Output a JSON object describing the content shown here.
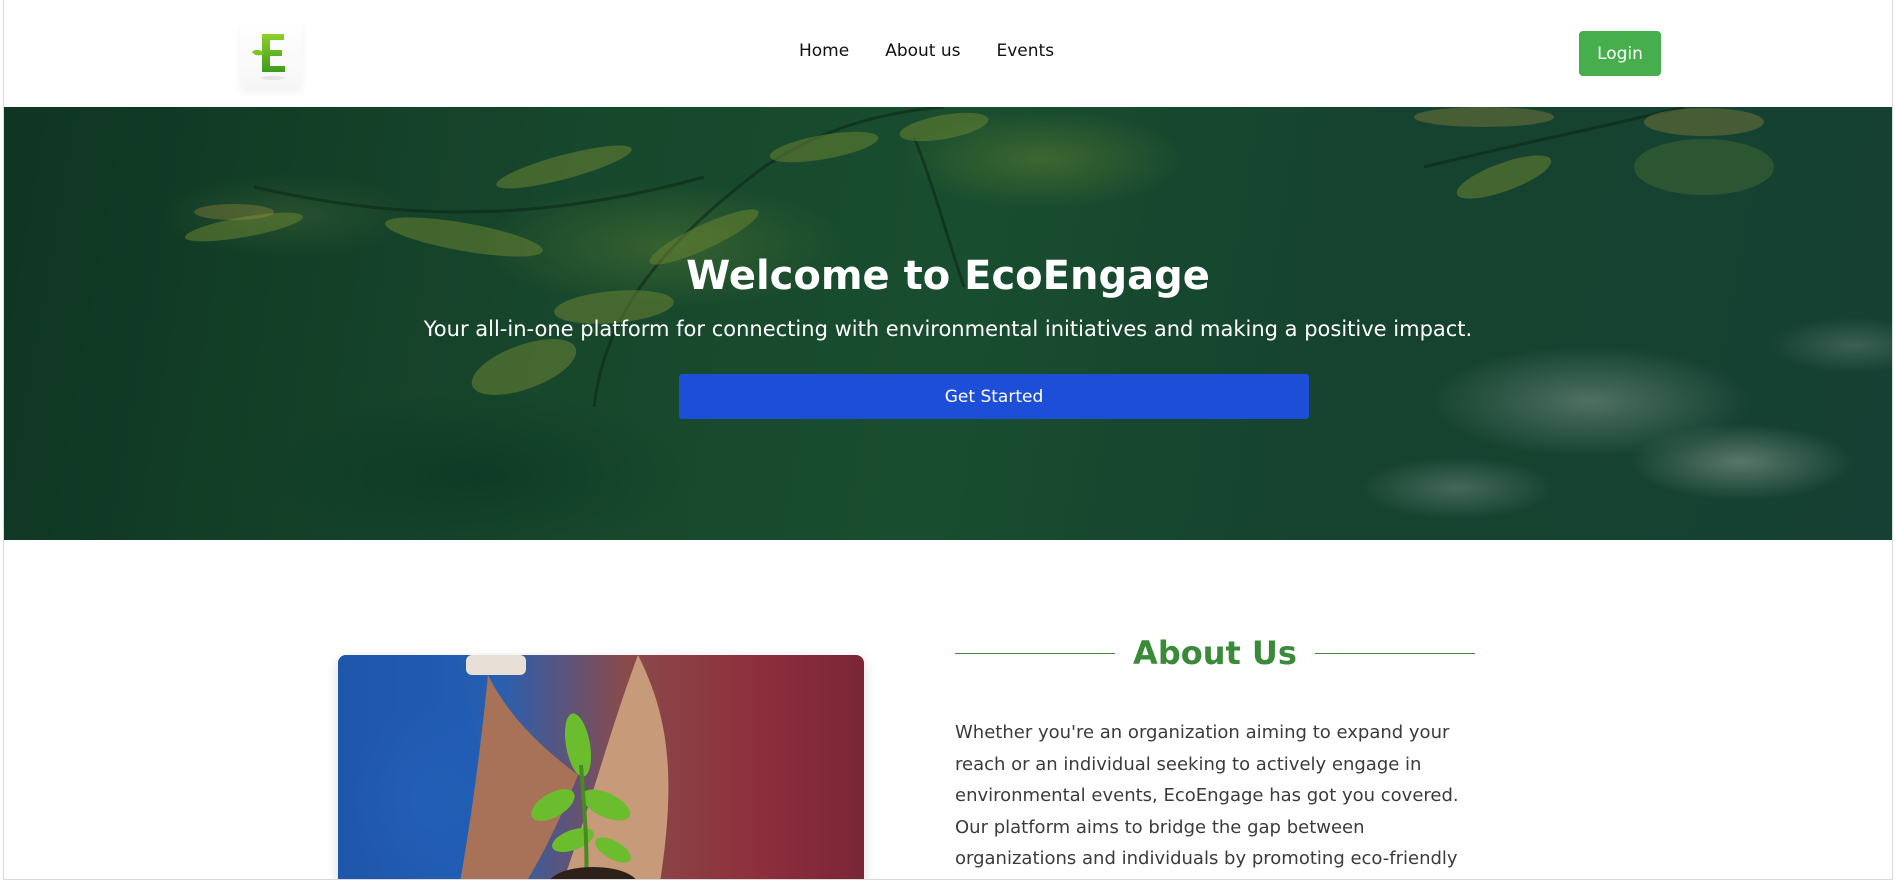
{
  "navbar": {
    "logo_letter": "E",
    "links": [
      "Home",
      "About us",
      "Events"
    ],
    "login_label": "Login"
  },
  "hero": {
    "title": "Welcome to EcoEngage",
    "subtitle": "Your all-in-one platform for connecting with environmental initiatives and making a positive impact.",
    "cta_label": "Get Started"
  },
  "about": {
    "heading": "About Us",
    "text": "Whether you're an organization aiming to expand your reach or an individual seeking to actively engage in environmental events, EcoEngage has got you covered. Our platform aims to bridge the gap between organizations and individuals by promoting eco-friendly"
  },
  "colors": {
    "brand_green": "#46ae4c",
    "heading_green": "#3a8a3a",
    "cta_blue": "#1d4ed8"
  },
  "icons": {
    "logo": "ecoengage-logo-icon"
  }
}
